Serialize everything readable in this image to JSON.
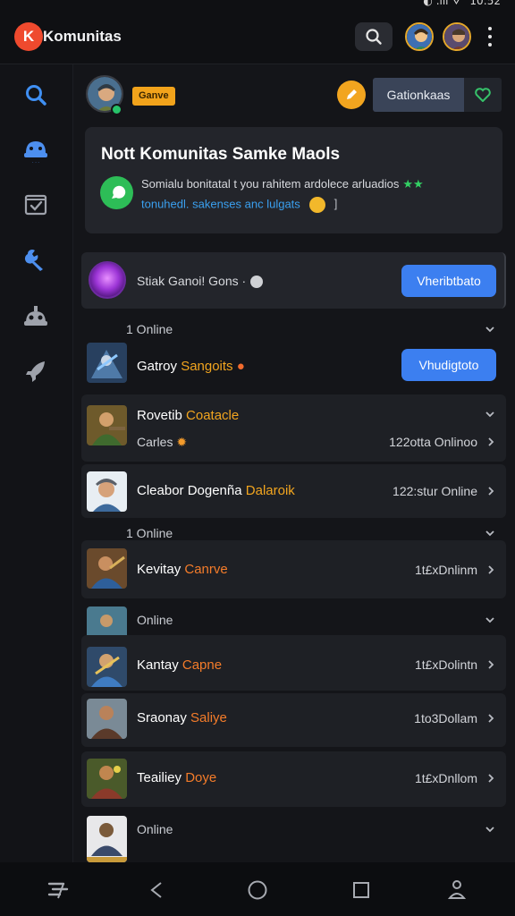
{
  "status": {
    "time": "10:52"
  },
  "app": {
    "title": "Komunitas",
    "logo_letter": "K"
  },
  "profile": {
    "game_badge": "Ganve"
  },
  "actions": {
    "game_option_label": "Gationkaas"
  },
  "banner": {
    "title": "Nott Komunitas Samke Maols",
    "line1": "Somialu bonitatal t you rahitem ardolece arluadios",
    "stars": "★★",
    "line2": "tonuhedl. sakenses  anc lulgats",
    "bracket": "]"
  },
  "featured": {
    "text": "Stiak Ganoi! Gons ·",
    "button": "Vheribtbato"
  },
  "sections": {
    "s1": "1 Online",
    "s2": "1 Online",
    "s3": "Online",
    "s4": "Online"
  },
  "rows": [
    {
      "title_a": "Gatroy",
      "title_b": "Sangoits",
      "button": "Vhudigtoto"
    },
    {
      "title_a": "Rovetib",
      "title_b": "Coatacle",
      "sub": "Carles",
      "count": "122otta Onlinoo"
    },
    {
      "title_a": "Cleabor Dogenña",
      "title_b": "Dalaroik",
      "count": "122:stur Online"
    },
    {
      "title_a": "Kevitay",
      "title_b": "Canrve",
      "count": "1t£xDnlinm"
    },
    {
      "title_a": "Kantay",
      "title_b": "Capne",
      "count": "1t£xDolintn"
    },
    {
      "title_a": "Sraonay",
      "title_b": "Saliye",
      "count": "1to3Dollam"
    },
    {
      "title_a": "Teailiey",
      "title_b": "Doye",
      "count": "1t£xDnllom"
    }
  ]
}
